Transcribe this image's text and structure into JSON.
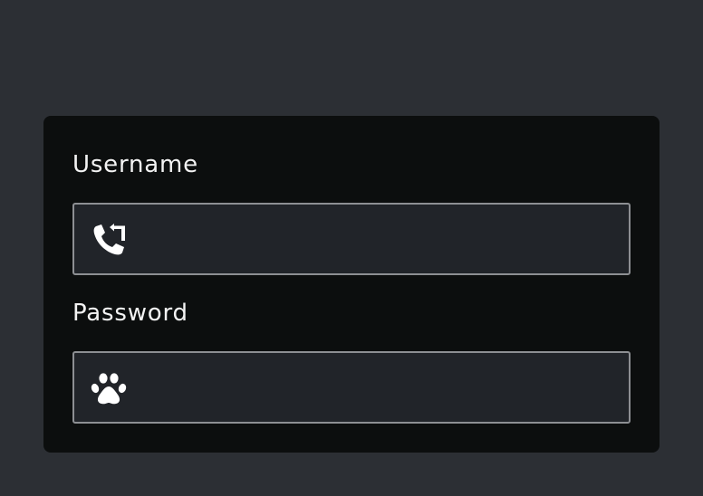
{
  "form": {
    "username": {
      "label": "Username",
      "value": "",
      "placeholder": "",
      "icon": "phone-forward-icon"
    },
    "password": {
      "label": "Password",
      "value": "",
      "placeholder": "",
      "icon": "paw-icon"
    }
  },
  "colors": {
    "page_background": "#2c2f34",
    "card_background": "#0c0e0e",
    "input_background": "#212429",
    "input_border": "#8d8f93",
    "text": "#f3f3f3"
  }
}
